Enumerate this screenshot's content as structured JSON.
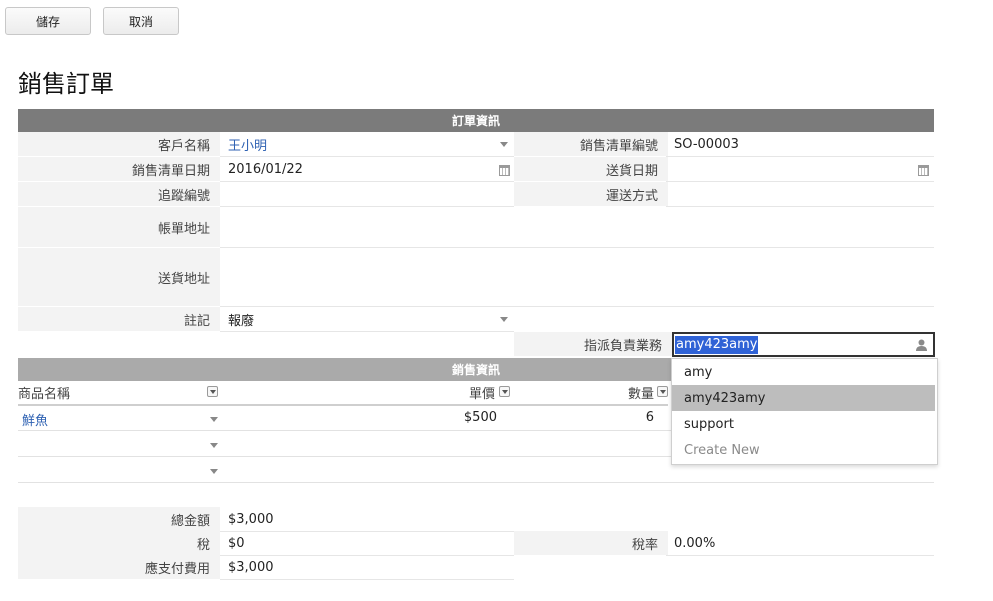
{
  "toolbar": {
    "save_label": "儲存",
    "cancel_label": "取消"
  },
  "page_title": "銷售訂單",
  "order_info": {
    "section_title": "訂單資訊",
    "customer_name": {
      "label": "客戶名稱",
      "value": "王小明"
    },
    "sales_order_no": {
      "label": "銷售清單編號",
      "value": "SO-00003"
    },
    "order_date": {
      "label": "銷售清單日期",
      "value": "2016/01/22"
    },
    "ship_date": {
      "label": "送貨日期",
      "value": ""
    },
    "tracking_no": {
      "label": "追蹤編號",
      "value": ""
    },
    "shipping_method": {
      "label": "運送方式",
      "value": ""
    },
    "billing_address": {
      "label": "帳單地址",
      "value": ""
    },
    "shipping_address": {
      "label": "送貨地址",
      "value": ""
    },
    "remark": {
      "label": "註記",
      "value": "報廢"
    },
    "assigned_sales": {
      "label": "指派負責業務",
      "value": "amy423amy"
    }
  },
  "assign_dropdown": {
    "options": [
      "amy",
      "amy423amy",
      "support",
      "Create New"
    ],
    "highlighted": "amy423amy"
  },
  "sales_info": {
    "section_title": "銷售資訊",
    "columns": {
      "product": "商品名稱",
      "unit_price": "單價",
      "quantity": "數量"
    },
    "rows": [
      {
        "product": "鮮魚",
        "unit_price": "$500",
        "quantity": "6"
      },
      {
        "product": "",
        "unit_price": "",
        "quantity": ""
      },
      {
        "product": "",
        "unit_price": "",
        "quantity": ""
      }
    ]
  },
  "totals": {
    "total": {
      "label": "總金額",
      "value": "$3,000"
    },
    "tax": {
      "label": "稅",
      "value": "$0"
    },
    "tax_rate": {
      "label": "稅率",
      "value": "0.00%"
    },
    "payable": {
      "label": "應支付費用",
      "value": "$3,000"
    }
  },
  "icons": {
    "calendar": "calendar-icon",
    "user": "user-icon",
    "dropdown": "chevron-down-icon",
    "filter": "column-filter-icon"
  },
  "colors": {
    "section_header": "#7b7b7b",
    "link": "#2f62b3",
    "selection": "#2f62d6"
  }
}
